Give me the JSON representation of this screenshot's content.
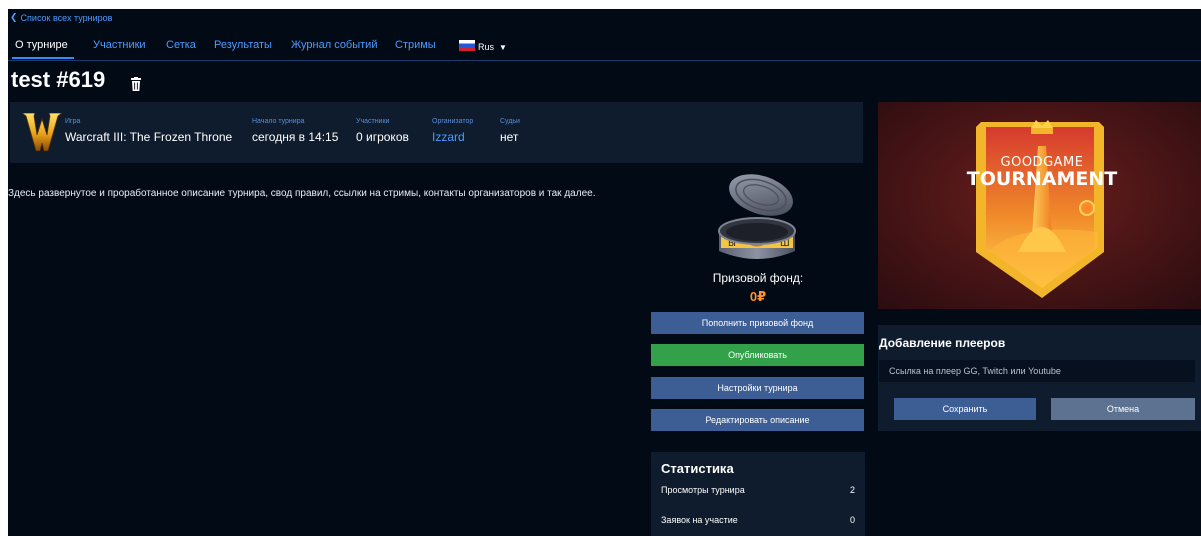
{
  "nav": {
    "back_label": "Список всех турниров"
  },
  "tabs": [
    {
      "label": "О турнире",
      "active": true
    },
    {
      "label": "Участники"
    },
    {
      "label": "Сетка"
    },
    {
      "label": "Результаты"
    },
    {
      "label": "Журнал событий"
    },
    {
      "label": "Стримы"
    }
  ],
  "language": {
    "label": "Rus",
    "flag": "russia-flag-icon"
  },
  "tournament": {
    "title": "test #619",
    "info": {
      "game_label": "Игра",
      "game_value": "Warcraft III: The Frozen Throne",
      "start_label": "Начало турнира",
      "start_value": "сегодня в 14:15",
      "participants_label": "Участники",
      "participants_value": "0 игроков",
      "organizer_label": "Организатор",
      "organizer_value": "Izzard",
      "judges_label": "Судьи",
      "judges_value": "нет"
    },
    "description": "Здесь развернутое и проработанное описание турнира, свод правил, ссылки на стримы, контакты организаторов и так далее."
  },
  "prize": {
    "label": "Призовой фонд:",
    "value": "0₽",
    "buttons": {
      "topup": "Пополнить призовой фонд",
      "publish": "Опубликовать",
      "settings": "Настройки турнира",
      "edit_description": "Редактировать описание"
    }
  },
  "stats": {
    "title": "Статистика",
    "rows": [
      {
        "label": "Просмотры турнира",
        "value": "2"
      },
      {
        "label": "Заявок на участие",
        "value": "0"
      }
    ]
  },
  "banner": {
    "line1": "GOODGAME",
    "line2": "TOURNAMENT"
  },
  "add_player": {
    "title": "Добавление плееров",
    "placeholder": "Ссылка на плеер GG, Twitch или Youtube",
    "save": "Сохранить",
    "cancel": "Отмена"
  },
  "colors": {
    "background": "#020a16",
    "panel": "#0f1c2e",
    "link": "#4e9bff",
    "button": "#3c5e95",
    "publish": "#33a04a",
    "prize": "#ff9328",
    "cancel": "#5c7290"
  }
}
